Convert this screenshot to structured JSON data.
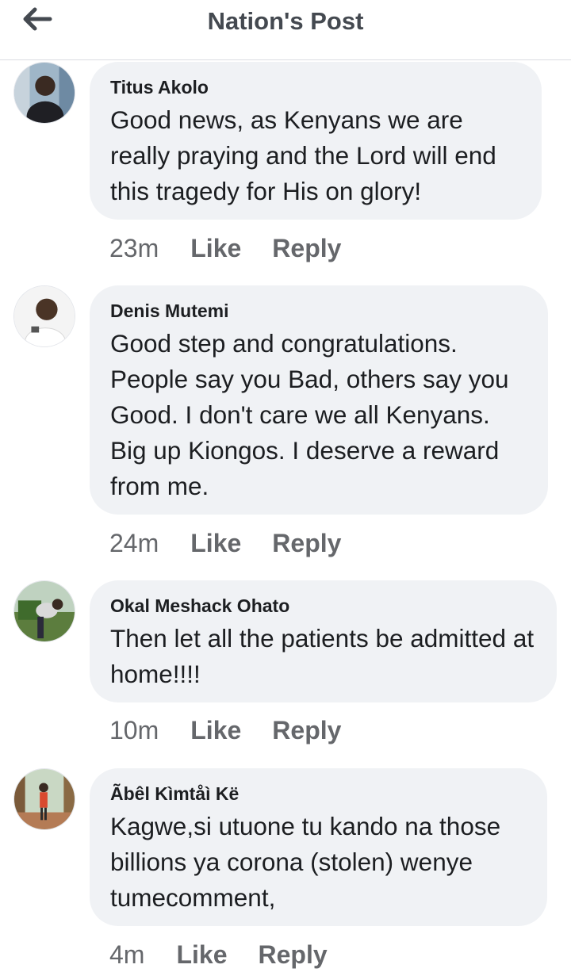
{
  "header": {
    "title": "Nation's Post",
    "back_icon": "arrow-left-icon"
  },
  "comments": [
    {
      "author": "Titus Akolo",
      "text": "Good news, as Kenyans we are really praying and the Lord will end this tragedy for His on glory!",
      "time": "23m",
      "like": "Like",
      "reply": "Reply"
    },
    {
      "author": "Denis Mutemi",
      "text": "Good step and congratulations. People say you Bad, others say you Good. I don't care we all Kenyans. Big up Kiongos. I deserve a reward from me.",
      "time": "24m",
      "like": "Like",
      "reply": "Reply"
    },
    {
      "author": "Okal Meshack Ohato",
      "text": "Then let all the patients be admitted at home!!!!",
      "time": "10m",
      "like": "Like",
      "reply": "Reply"
    },
    {
      "author": "Ãbêl Kìmtåì Kë",
      "text": "Kagwe,si utuone tu kando na those billions ya corona (stolen) wenye tumecomment,",
      "time": "4m",
      "like": "Like",
      "reply": "Reply"
    }
  ],
  "colors": {
    "bubble": "#f0f2f5",
    "meta": "#65676b",
    "title": "#444950"
  }
}
